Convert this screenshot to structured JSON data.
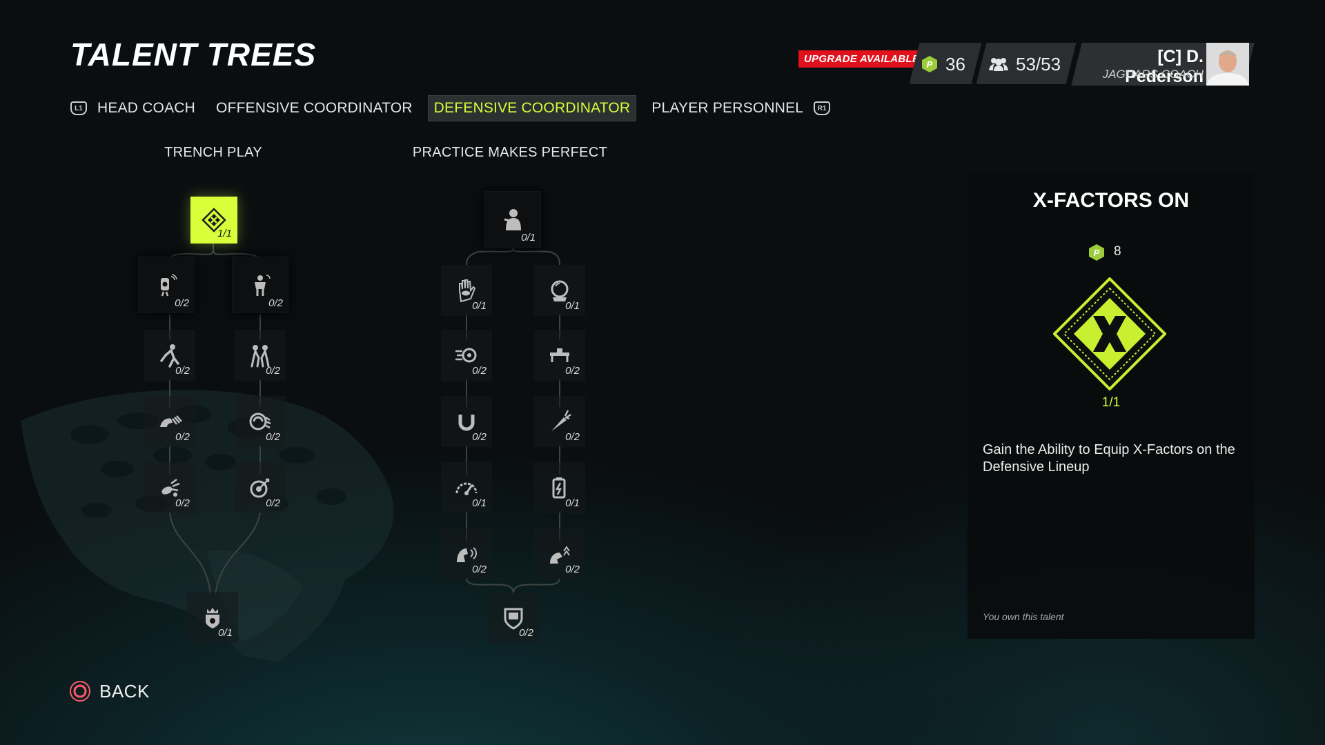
{
  "page": {
    "title": "TALENT TREES"
  },
  "tabs": {
    "left_bumper": "L1",
    "right_bumper": "R1",
    "items": [
      {
        "label": "HEAD COACH"
      },
      {
        "label": "OFFENSIVE COORDINATOR"
      },
      {
        "label": "DEFENSIVE COORDINATOR"
      },
      {
        "label": "PLAYER PERSONNEL"
      }
    ],
    "active_index": 2
  },
  "status": {
    "upgrade_label": "UPGRADE AVAILABLE",
    "talent_points": "36",
    "staff_points": "53/53",
    "coach_name": "[C] D. Pederson",
    "coach_role": "JAGUARS COACH"
  },
  "trees": {
    "trench": {
      "title": "TRENCH PLAY",
      "nodes": [
        {
          "rank": "1/1",
          "icon": "x-factor-icon"
        },
        {
          "rank": "0/2",
          "icon": "pass-rusher-icon"
        },
        {
          "rank": "0/2",
          "icon": "run-stopper-icon"
        },
        {
          "rank": "0/2",
          "icon": "tackle-icon"
        },
        {
          "rank": "0/2",
          "icon": "block-shed-icon"
        },
        {
          "rank": "0/2",
          "icon": "power-move-icon"
        },
        {
          "rank": "0/2",
          "icon": "finesse-move-icon"
        },
        {
          "rank": "0/2",
          "icon": "strip-ball-icon"
        },
        {
          "rank": "0/2",
          "icon": "target-icon"
        },
        {
          "rank": "0/1",
          "icon": "crown-badge-icon"
        }
      ]
    },
    "practice": {
      "title": "PRACTICE MAKES PERFECT",
      "nodes": [
        {
          "rank": "0/1",
          "icon": "player-icon"
        },
        {
          "rank": "0/1",
          "icon": "hand-eye-icon"
        },
        {
          "rank": "0/1",
          "icon": "crystal-ball-icon"
        },
        {
          "rank": "0/2",
          "icon": "speed-wheel-icon"
        },
        {
          "rank": "0/2",
          "icon": "bench-icon"
        },
        {
          "rank": "0/2",
          "icon": "magnet-icon"
        },
        {
          "rank": "0/2",
          "icon": "carrot-icon"
        },
        {
          "rank": "0/1",
          "icon": "speedometer-icon"
        },
        {
          "rank": "0/1",
          "icon": "battery-icon"
        },
        {
          "rank": "0/2",
          "icon": "shout-icon"
        },
        {
          "rank": "0/2",
          "icon": "boost-icon"
        },
        {
          "rank": "0/2",
          "icon": "shield-badge-icon"
        }
      ]
    }
  },
  "detail": {
    "title": "X-FACTORS ON",
    "cost": "8",
    "rank": "1/1",
    "description": "Gain the Ability to Equip X-Factors on the Defensive Lineup",
    "owned_note": "You own this talent"
  },
  "back": {
    "label": "BACK"
  },
  "colors": {
    "accent": "#d7ff3a",
    "upgrade": "#e0101c",
    "panel": "#0a0c0d"
  }
}
